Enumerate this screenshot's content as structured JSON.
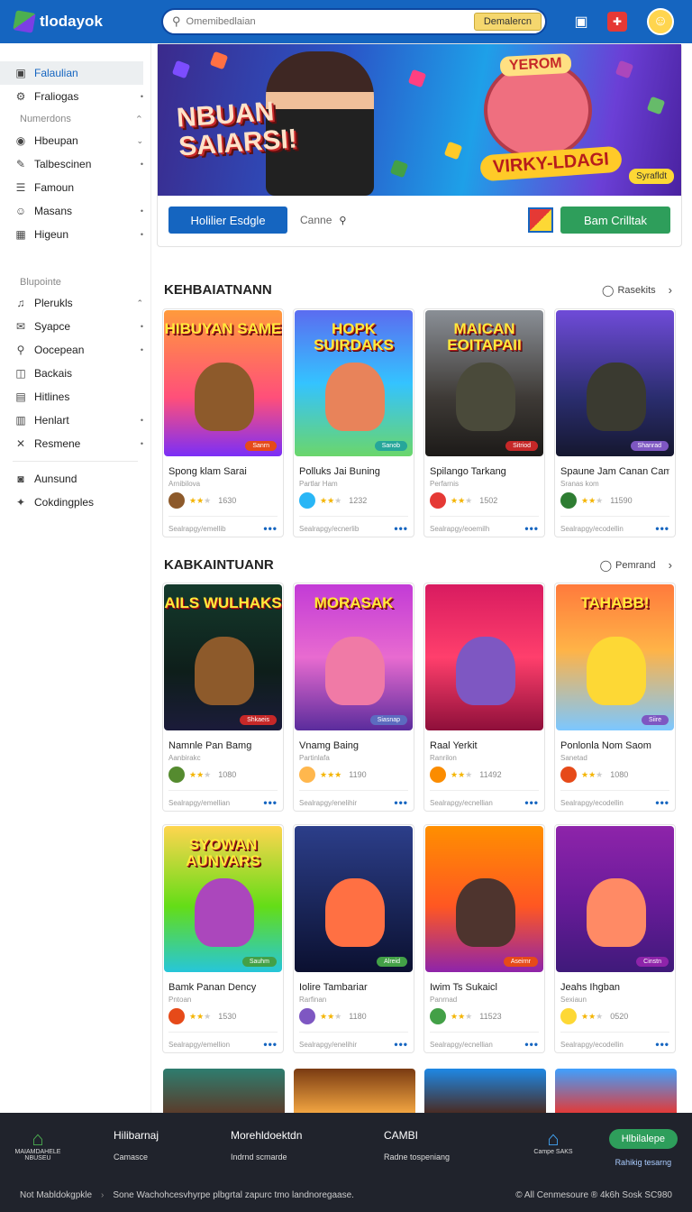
{
  "header": {
    "logo_text": "tlodayok",
    "search_placeholder": "Omemibedlaian",
    "search_button": "Demalercn"
  },
  "sidebar": {
    "items_a": [
      {
        "icon": "▣",
        "icon_name": "folder-icon",
        "label": "Falaulian",
        "active": true,
        "chevron": ""
      },
      {
        "icon": "⚙",
        "icon_name": "gear-icon",
        "label": "Fraliogas",
        "chevron": "•"
      }
    ],
    "head1": "Numerdons",
    "items_b": [
      {
        "icon": "◉",
        "icon_name": "compass-icon",
        "label": "Hbeupan",
        "chevron": "⌄"
      },
      {
        "icon": "✎",
        "icon_name": "pen-icon",
        "label": "Talbescinen",
        "chevron": "•"
      },
      {
        "icon": "☰",
        "icon_name": "list-icon",
        "label": "Famoun",
        "chevron": ""
      },
      {
        "icon": "☺",
        "icon_name": "people-icon",
        "label": "Masans",
        "chevron": "•"
      },
      {
        "icon": "▦",
        "icon_name": "grid-icon",
        "label": "Higeun",
        "chevron": "•"
      }
    ],
    "head2": "Blupointe",
    "items_c": [
      {
        "icon": "♫",
        "icon_name": "music-icon",
        "label": "Plerukls",
        "chevron": "⌃"
      },
      {
        "icon": "✉",
        "icon_name": "mail-icon",
        "label": "Syapce",
        "chevron": "•"
      },
      {
        "icon": "⚲",
        "icon_name": "search-icon",
        "label": "Oocepean",
        "chevron": "•"
      },
      {
        "icon": "◫",
        "icon_name": "image-icon",
        "label": "Backais",
        "chevron": ""
      },
      {
        "icon": "▤",
        "icon_name": "table-icon",
        "label": "Hitlines",
        "chevron": ""
      },
      {
        "icon": "▥",
        "icon_name": "calendar-icon",
        "label": "Henlart",
        "chevron": "•"
      },
      {
        "icon": "✕",
        "icon_name": "close-icon",
        "label": "Resmene",
        "chevron": "•"
      }
    ],
    "items_d": [
      {
        "icon": "◙",
        "icon_name": "account-icon",
        "label": "Aunsund"
      },
      {
        "icon": "✦",
        "icon_name": "puzzle-icon",
        "label": "Cokdingples"
      }
    ]
  },
  "banner": {
    "title_line1": "NBUAN",
    "title_line2": "SAIARSI!",
    "yerom": "YEROM",
    "ribbon": "VIRKY-LDAGI",
    "badge": "Syrafldt",
    "primary_button": "Holilier Esdgle",
    "category_label": "Canne",
    "green_button": "Bam Crilltak"
  },
  "sections": [
    {
      "title": "KEHBAIATNANN",
      "more": "Rasekits",
      "cards": [
        {
          "name": "Spong klam Sarai",
          "sub": "Arnibilova",
          "rating": 2,
          "count": "1630",
          "footer": "Sealrapgy/emellib",
          "art_title": "HIBUYAN SAME",
          "tag": "Sanrn",
          "bg": "linear-gradient(#ff9a3c,#ff4f7a 60%,#7b2ff7)",
          "char": "#8d5a2b",
          "tagbg": "#e64a19",
          "av": "#8d5a2b"
        },
        {
          "name": "Polluks Jai Buning",
          "sub": "Partlar Ham",
          "rating": 2,
          "count": "1232",
          "footer": "Sealrapgy/ecnerlib",
          "art_title": "HOPK SUIRDAKS",
          "tag": "Sanob",
          "bg": "linear-gradient(#5b6cf0,#34c3ff 50%,#6bd66b)",
          "char": "#e8835a",
          "tagbg": "#26a69a",
          "av": "#29b6f6"
        },
        {
          "name": "Spilango Tarkang",
          "sub": "Perfarnis",
          "rating": 2,
          "count": "1502",
          "footer": "Sealrapgy/eoemilh",
          "art_title": "MAICAN EOITAPAII",
          "tag": "Sitriod",
          "bg": "linear-gradient(#8a8f96,#3e3a36 60%,#1c1a18)",
          "char": "#4a4a3a",
          "tagbg": "#c62828",
          "av": "#e53935"
        },
        {
          "name": "Spaune Jam Canan Cam",
          "sub": "Sranas kom",
          "rating": 2,
          "count": "11590",
          "footer": "Sealrapgy/ecodellin",
          "art_title": "",
          "tag": "Shanrad",
          "bg": "linear-gradient(#6f4bd8,#2a2d6e 60%,#15172f)",
          "char": "#3a3a30",
          "tagbg": "#7e57c2",
          "av": "#2e7d32"
        }
      ]
    },
    {
      "title": "KABKAINTUANR",
      "more": "Pemrand",
      "cards": [
        {
          "name": "Namnle Pan Bamg",
          "sub": "Aanbirakc",
          "rating": 2,
          "count": "1080",
          "footer": "Sealrapgy/emellian",
          "art_title": "AILS WULHAKS",
          "tag": "Shkaeis",
          "bg": "linear-gradient(#143a2c,#0e1e1a 60%,#1b1b3a)",
          "char": "#8d5a2b",
          "tagbg": "#c62828",
          "av": "#558b2f"
        },
        {
          "name": "Vnamg Baing",
          "sub": "Partinlafa",
          "rating": 3,
          "count": "1190",
          "footer": "Sealrapgy/enelihir",
          "art_title": "MORASAK",
          "tag": "Siasnap",
          "bg": "linear-gradient(#c23bd6,#e86bd0 50%,#5a2c9c)",
          "char": "#f07aa6",
          "tagbg": "#5c6bc0",
          "av": "#ffb74d"
        },
        {
          "name": "Raal Yerkit",
          "sub": "Ranrilon",
          "rating": 2,
          "count": "11492",
          "footer": "Sealrapgy/ecnellian",
          "art_title": "",
          "tag": "",
          "bg": "linear-gradient(#d81b60,#ff3f6c 50%,#8e0f3a)",
          "char": "#7e57c2",
          "tagbg": "#c62828",
          "av": "#fb8c00"
        },
        {
          "name": "Ponlonla Nom Saom",
          "sub": "Sanetad",
          "rating": 2,
          "count": "1080",
          "footer": "Sealrapgy/ecodellin",
          "art_title": "TAHABB!",
          "tag": "Siire",
          "bg": "linear-gradient(#ff7a3c,#ffb347 45%,#7cc7ff)",
          "char": "#fdd835",
          "tagbg": "#7e57c2",
          "av": "#e64a19"
        }
      ]
    },
    {
      "title": "",
      "more": "",
      "cards": [
        {
          "name": "Bamk Panan Dency",
          "sub": "Pntoan",
          "rating": 2,
          "count": "1530",
          "footer": "Sealrapgy/emellion",
          "art_title": "SYOWAN AUNVARS",
          "tag": "Sauhm",
          "bg": "linear-gradient(#ffd54f,#64dd17 55%,#26c6da)",
          "char": "#ab47bc",
          "tagbg": "#43a047",
          "av": "#e64a19"
        },
        {
          "name": "Iolire Tambariar",
          "sub": "Rarfinan",
          "rating": 2,
          "count": "1180",
          "footer": "Sealrapgy/enelihir",
          "art_title": "",
          "tag": "Alreid",
          "bg": "linear-gradient(#2c3e8a,#182354 60%,#0b1030)",
          "char": "#ff7043",
          "tagbg": "#43a047",
          "av": "#7e57c2"
        },
        {
          "name": "Iwim Ts Sukaicl",
          "sub": "Panrnad",
          "rating": 2,
          "count": "11523",
          "footer": "Sealrapgy/ecnellian",
          "art_title": "",
          "tag": "Aseirnr",
          "bg": "linear-gradient(#ff8f00,#ff5722 55%,#8e24aa)",
          "char": "#4e342e",
          "tagbg": "#e64a19",
          "av": "#43a047"
        },
        {
          "name": "Jeahs Ihgban",
          "sub": "Sexiaun",
          "rating": 2,
          "count": "0520",
          "footer": "Sealrapgy/ecodellin",
          "art_title": "",
          "tag": "Cinstn",
          "bg": "linear-gradient(#8e24aa,#6a1b9a 50%,#3f1a7a)",
          "char": "#ff8a65",
          "tagbg": "#8e24aa",
          "av": "#fdd835"
        }
      ]
    }
  ],
  "partial_bgs": [
    "linear-gradient(#2e7d6f,#5b3b2a)",
    "linear-gradient(#7a3b12,#f4a742)",
    "linear-gradient(#1e88e5,#4a2a20)",
    "linear-gradient(#3fa0ff,#e53935)"
  ],
  "footer": {
    "home_label": "MAIAMDAHELE NBUSEU",
    "col1_title": "Hilibarnaj",
    "col1_sub": "Camasce",
    "col2_title": "Morehldoektdn",
    "col2_sub": "Indrnd scmarde",
    "col3_title": "CAMBI",
    "col3_sub": "Radne tospeniang",
    "shop_label": "Campe SAKS",
    "button": "Hlbilalepe",
    "button_sub": "Rahikig tesarng",
    "bottom_left": "Not Mabldokgpkle",
    "bottom_mid": "Sone Wachohcesvhyrpe plbgrtal zapurc tmo landnoregaase.",
    "copyright": "© All Cenmesoure ® 4k6h Sosk SC980"
  }
}
